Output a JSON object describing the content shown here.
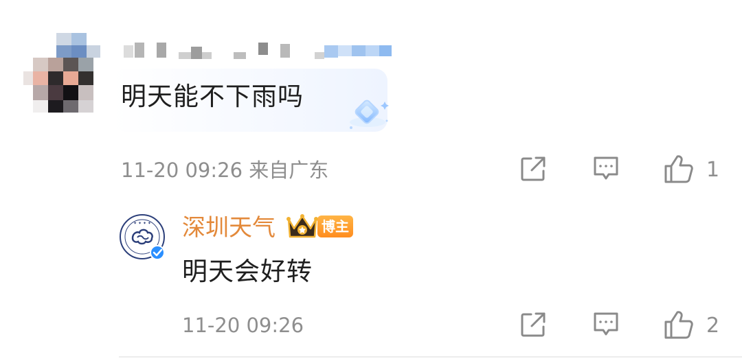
{
  "comment": {
    "text": "明天能不下雨吗",
    "meta": "11-20 09:26 来自广东",
    "like_count": "1",
    "icons": [
      "share-icon",
      "comment-icon",
      "like-icon"
    ]
  },
  "reply": {
    "author": "深圳天气",
    "badge": "博主",
    "text": "明天会好转",
    "meta": "11-20 09:26",
    "like_count": "2",
    "icons": [
      "share-icon",
      "comment-icon",
      "like-icon",
      "crown-icon",
      "verified-icon"
    ]
  },
  "colors": {
    "author_name": "#e3893a",
    "badge": "#ff9a2a",
    "verified": "#2a8fff",
    "meta": "#8e8e8e",
    "icon": "#8a8a8a"
  }
}
